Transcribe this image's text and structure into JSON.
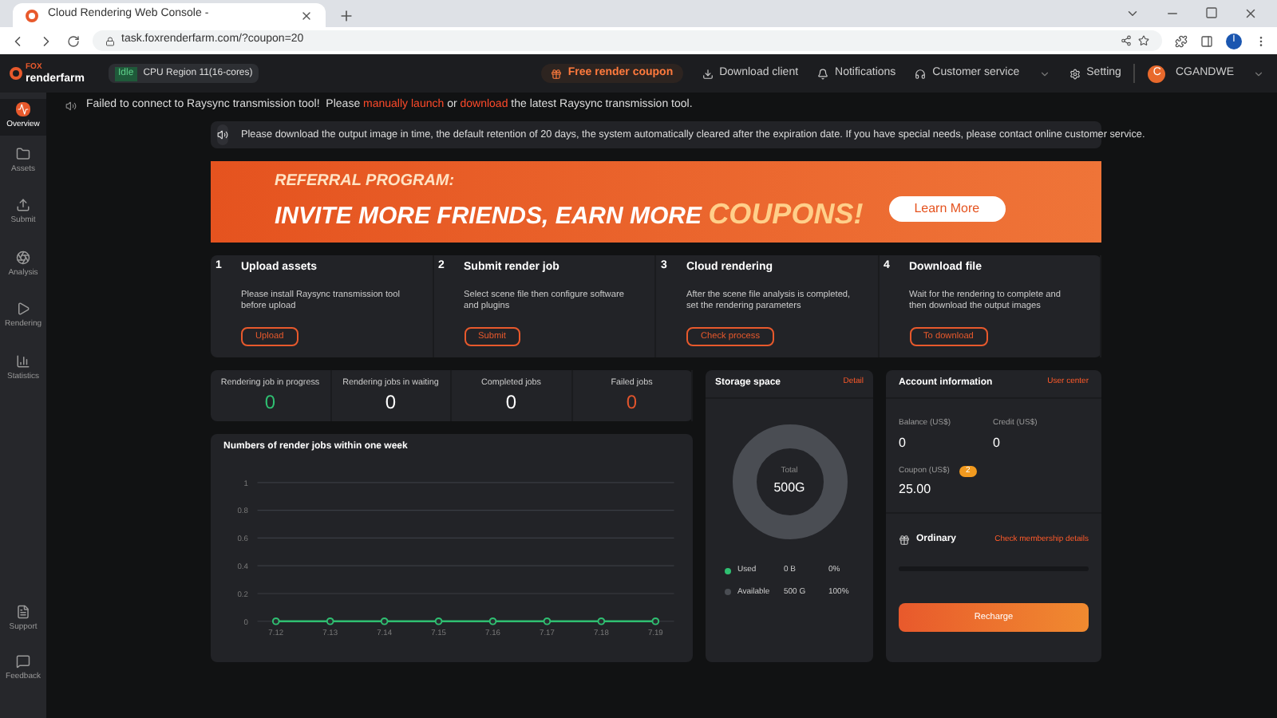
{
  "browser": {
    "tab_title": "Cloud Rendering Web Console -",
    "url": "task.foxrenderfarm.com/?coupon=20",
    "profile_initial": "I"
  },
  "header": {
    "logo_top": "FOX",
    "logo_bottom": "renderfarm",
    "status": "Idle",
    "region": "CPU Region 11(16-cores)",
    "coupon": "Free render coupon",
    "links": [
      "Download client",
      "Notifications",
      "Customer service",
      "Setting"
    ],
    "avatar_initial": "C",
    "user": "CGANDWE"
  },
  "alert": {
    "text": "Failed to connect to Raysync transmission tool!  Please ",
    "link1": "manually launch",
    "middle": " or ",
    "link2": "download",
    "end": " the latest Raysync transmission tool."
  },
  "sidebar": {
    "items": [
      {
        "label": "Overview",
        "selected": true
      },
      {
        "label": "Assets",
        "selected": false
      },
      {
        "label": "Submit",
        "selected": false
      },
      {
        "label": "Analysis",
        "selected": false
      },
      {
        "label": "Rendering",
        "selected": false
      },
      {
        "label": "Statistics",
        "selected": false
      }
    ],
    "bottom": [
      "Support",
      "Feedback"
    ]
  },
  "notice": "Please download the output image in time, the default retention of 20 days, the system automatically cleared after the expiration date. If you have special needs, please contact online customer service.",
  "banner": {
    "subtitle": "REFERRAL PROGRAM:",
    "title": "INVITE MORE FRIENDS, EARN MORE ",
    "highlight": "COUPONS!",
    "button": "Learn More"
  },
  "steps": [
    {
      "number": "1",
      "title": "Upload assets",
      "description": "Please install Raysync transmission tool before upload",
      "button": "Upload"
    },
    {
      "number": "2",
      "title": "Submit render job",
      "description": "Select scene file then configure software and plugins",
      "button": "Submit"
    },
    {
      "number": "3",
      "title": "Cloud rendering",
      "description": "After the scene file analysis is completed, set the rendering parameters",
      "button": "Check process"
    },
    {
      "number": "4",
      "title": "Download file",
      "description": "Wait for the rendering to complete and then download the output images",
      "button": "To download"
    }
  ],
  "job_stats": [
    {
      "label": "Rendering job in progress",
      "value": "0",
      "color": "#2fbf71"
    },
    {
      "label": "Rendering jobs in waiting",
      "value": "0",
      "color": "#ffffff"
    },
    {
      "label": "Completed jobs",
      "value": "0",
      "color": "#ffffff"
    },
    {
      "label": "Failed jobs",
      "value": "0",
      "color": "#e0542c"
    }
  ],
  "weekly_chart": {
    "title": "Numbers of render jobs within one week",
    "chart_data": {
      "type": "line",
      "categories": [
        "7.12",
        "7.13",
        "7.14",
        "7.15",
        "7.16",
        "7.17",
        "7.18",
        "7.19"
      ],
      "series": [
        {
          "color": "#2fbf71",
          "marker": "circle",
          "values": [
            0,
            0,
            0,
            0,
            0,
            0,
            0,
            0
          ]
        }
      ],
      "grid": true,
      "ylim": [
        0,
        1
      ],
      "yticks": [
        0,
        0.2,
        0.4,
        0.6,
        0.8,
        1
      ]
    }
  },
  "storage": {
    "title": "Storage space",
    "link": "Detail",
    "total_label": "Total",
    "total": "500G",
    "legend": [
      {
        "label": "Used",
        "size": "0 B",
        "percent": "0%",
        "color": "#2fbf71"
      },
      {
        "label": "Available",
        "size": "500 G",
        "percent": "100%",
        "color": "#4a4d53"
      }
    ]
  },
  "account": {
    "title": "Account information",
    "link": "User center",
    "balance_label": "Balance (US$)",
    "balance": "0",
    "credit_label": "Credit (US$)",
    "credit": "0",
    "coupon_label": "Coupon (US$)",
    "coupon_count": "2",
    "coupon": "25.00",
    "tier": "Ordinary",
    "membership_link": "Check membership details",
    "membership_progress": {
      "level": 0
    },
    "button": "Recharge"
  }
}
